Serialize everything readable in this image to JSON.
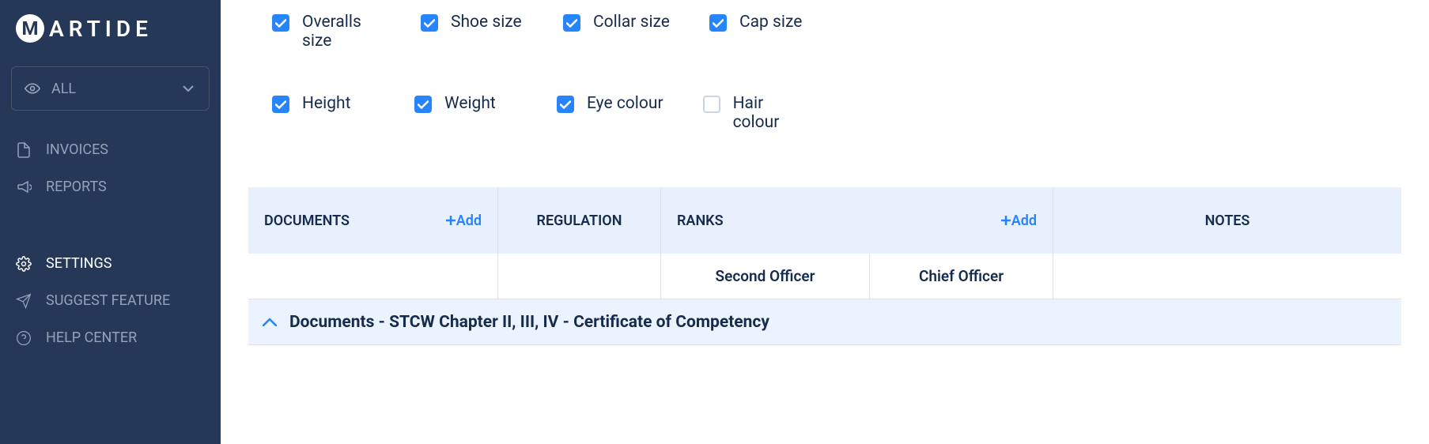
{
  "brand": "ARTIDE",
  "brand_letter": "M",
  "sidebar": {
    "dropdown_label": "ALL",
    "items": [
      {
        "label": "INVOICES",
        "active": false,
        "icon": "file-icon"
      },
      {
        "label": "REPORTS",
        "active": false,
        "icon": "megaphone-icon"
      },
      {
        "label": "SETTINGS",
        "active": true,
        "icon": "gear-icon"
      },
      {
        "label": "SUGGEST FEATURE",
        "active": false,
        "icon": "paper-plane-icon"
      },
      {
        "label": "HELP CENTER",
        "active": false,
        "icon": "question-icon"
      }
    ]
  },
  "checkboxes": {
    "row1": [
      {
        "label": "Overalls size",
        "checked": true
      },
      {
        "label": "Shoe size",
        "checked": true
      },
      {
        "label": "Collar size",
        "checked": true
      },
      {
        "label": "Cap size",
        "checked": true
      }
    ],
    "row2": [
      {
        "label": "Height",
        "checked": true
      },
      {
        "label": "Weight",
        "checked": true
      },
      {
        "label": "Eye colour",
        "checked": true
      },
      {
        "label": "Hair colour",
        "checked": false
      }
    ]
  },
  "table": {
    "headers": {
      "documents": "DOCUMENTS",
      "regulation": "REGULATION",
      "ranks": "RANKS",
      "notes": "NOTES",
      "add_label": "Add"
    },
    "rank_cells": {
      "rank1": "Second Officer",
      "rank2": "Chief Officer"
    },
    "group_title": "Documents - STCW Chapter II, III, IV - Certificate of Competency"
  }
}
